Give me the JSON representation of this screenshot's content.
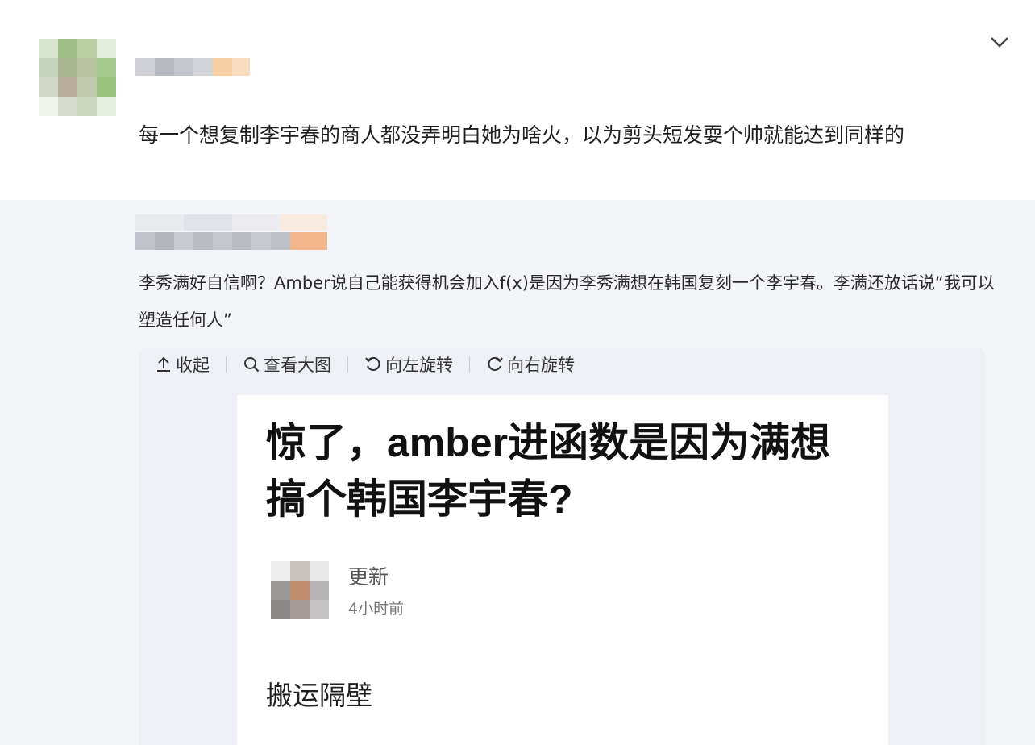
{
  "post": {
    "text": "每一个想复制李宇春的商人都没弄明白她为啥火，以为剪头短发耍个帅就能达到同样的"
  },
  "repost": {
    "text": "李秀满好自信啊？Amber说自己能获得机会加入f(x)是因为李秀满想在韩国复刻一个李宇春。李满还放话说“我可以塑造任何人”"
  },
  "toolbar": {
    "collapse_label": "收起",
    "view_large_label": "查看大图",
    "rotate_left_label": "向左旋转",
    "rotate_right_label": "向右旋转"
  },
  "image": {
    "title": "惊了，amber进函数是因为满想搞个韩国李宇春?",
    "author": "更新",
    "time": "4小时前",
    "body": "搬运隔壁"
  },
  "icons": {
    "collapse": "up-arrow-icon",
    "view_large": "magnifier-icon",
    "rotate_left": "rotate-left-icon",
    "rotate_right": "rotate-right-icon",
    "chevron": "chevron-down-icon"
  }
}
